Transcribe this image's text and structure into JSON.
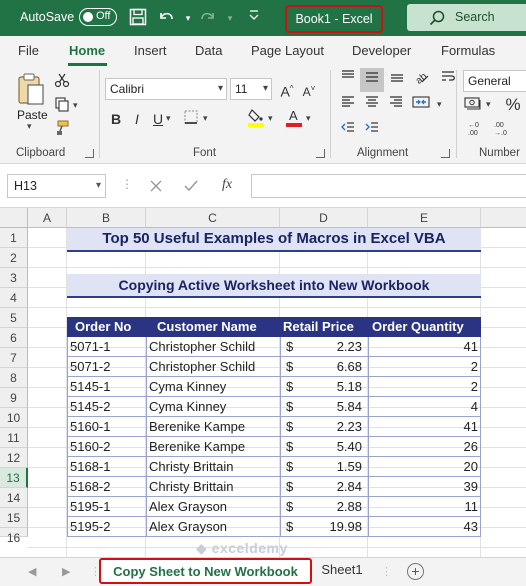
{
  "titlebar": {
    "autosave_label": "AutoSave",
    "autosave_state": "Off",
    "book_title": "Book1  -  Excel",
    "search_label": "Search"
  },
  "ribbon_tabs": [
    "File",
    "Home",
    "Insert",
    "Data",
    "Page Layout",
    "Developer",
    "Formulas"
  ],
  "ribbon": {
    "clipboard_label": "Clipboard",
    "paste_label": "Paste",
    "font_label": "Font",
    "font_name": "Calibri",
    "font_size": "11",
    "bold": "B",
    "italic": "I",
    "underline": "U",
    "alignment_label": "Alignment",
    "number_label": "Number",
    "number_format": "General",
    "percent": "%"
  },
  "formula_bar": {
    "name_box": "H13",
    "fx": "fx",
    "formula": ""
  },
  "columns": [
    "A",
    "B",
    "C",
    "D",
    "E"
  ],
  "rows": [
    "1",
    "2",
    "3",
    "4",
    "5",
    "6",
    "7",
    "8",
    "9",
    "10",
    "11",
    "12",
    "13",
    "14",
    "15",
    "16"
  ],
  "selected_row": "13",
  "sheet": {
    "title": "Top 50 Useful Examples of Macros in Excel VBA",
    "subtitle": "Copying Active Worksheet into New Workbook",
    "headers": [
      "Order No",
      "Customer Name",
      "Retail Price",
      "Order Quantity"
    ],
    "currency": "$",
    "data": [
      {
        "order": "5071-1",
        "name": "Christopher Schild",
        "price": "2.23",
        "qty": "41"
      },
      {
        "order": "5071-2",
        "name": "Christopher Schild",
        "price": "6.68",
        "qty": "2"
      },
      {
        "order": "5145-1",
        "name": "Cyma Kinney",
        "price": "5.18",
        "qty": "2"
      },
      {
        "order": "5145-2",
        "name": "Cyma Kinney",
        "price": "5.84",
        "qty": "4"
      },
      {
        "order": "5160-1",
        "name": "Berenike Kampe",
        "price": "2.23",
        "qty": "41"
      },
      {
        "order": "5160-2",
        "name": "Berenike Kampe",
        "price": "5.40",
        "qty": "26"
      },
      {
        "order": "5168-1",
        "name": "Christy Brittain",
        "price": "1.59",
        "qty": "20"
      },
      {
        "order": "5168-2",
        "name": "Christy Brittain",
        "price": "2.84",
        "qty": "39"
      },
      {
        "order": "5195-1",
        "name": "Alex Grayson",
        "price": "2.88",
        "qty": "11"
      },
      {
        "order": "5195-2",
        "name": "Alex Grayson",
        "price": "19.98",
        "qty": "43"
      }
    ]
  },
  "sheet_tabs": {
    "active": "Copy Sheet to New Workbook",
    "other": "Sheet1",
    "add": "+"
  },
  "watermark": "exceldemy",
  "colors": {
    "excel_green": "#217346",
    "header_navy": "#2a3483",
    "banner_fill": "#dfe3f3",
    "highlight_red": "#d01010"
  }
}
